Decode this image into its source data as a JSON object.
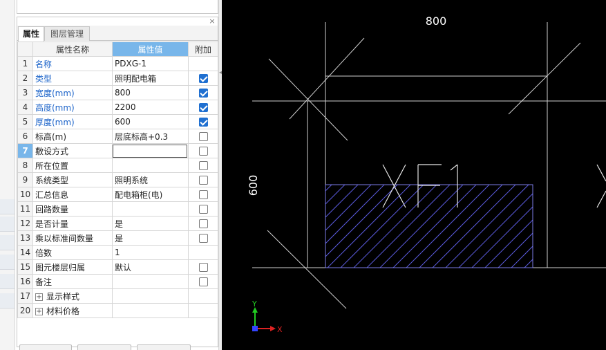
{
  "panel": {
    "close_glyph": "×",
    "tabs": {
      "properties": "属性",
      "layers": "图层管理"
    },
    "columns": {
      "name": "属性名称",
      "value": "属性值",
      "extra": "附加"
    },
    "rows": [
      {
        "num": "1",
        "name": "名称",
        "value": "PDXG-1",
        "blue": true,
        "check": null
      },
      {
        "num": "2",
        "name": "类型",
        "value": "照明配电箱",
        "blue": true,
        "check": true
      },
      {
        "num": "3",
        "name": "宽度(mm)",
        "value": "800",
        "blue": true,
        "check": true
      },
      {
        "num": "4",
        "name": "高度(mm)",
        "value": "2200",
        "blue": true,
        "check": true
      },
      {
        "num": "5",
        "name": "厚度(mm)",
        "value": "600",
        "blue": true,
        "check": true
      },
      {
        "num": "6",
        "name": "标高(m)",
        "value": "层底标高+0.3",
        "blue": false,
        "check": false
      },
      {
        "num": "7",
        "name": "敷设方式",
        "value": "",
        "blue": false,
        "check": false,
        "selected": true,
        "editing": true
      },
      {
        "num": "8",
        "name": "所在位置",
        "value": "",
        "blue": false,
        "check": false
      },
      {
        "num": "9",
        "name": "系统类型",
        "value": "照明系统",
        "blue": false,
        "check": false
      },
      {
        "num": "10",
        "name": "汇总信息",
        "value": "配电箱柜(电)",
        "blue": false,
        "check": false
      },
      {
        "num": "11",
        "name": "回路数量",
        "value": "",
        "blue": false,
        "check": false
      },
      {
        "num": "12",
        "name": "是否计量",
        "value": "是",
        "blue": false,
        "check": false
      },
      {
        "num": "13",
        "name": "乘以标准间数量",
        "value": "是",
        "blue": false,
        "check": false
      },
      {
        "num": "14",
        "name": "倍数",
        "value": "1",
        "blue": false,
        "check": null
      },
      {
        "num": "15",
        "name": "图元楼层归属",
        "value": "默认",
        "blue": false,
        "check": false
      },
      {
        "num": "16",
        "name": "备注",
        "value": "",
        "blue": false,
        "check": false
      },
      {
        "num": "17",
        "name": "显示样式",
        "value": "",
        "blue": false,
        "check": null,
        "group": true
      },
      {
        "num": "20",
        "name": "材料价格",
        "value": "",
        "blue": false,
        "check": null,
        "group": true
      }
    ],
    "expander_glyph": "+"
  },
  "canvas": {
    "dimension_top": "800",
    "dimension_left": "600",
    "label": "XF1",
    "axis_y": "Y",
    "axis_x": "X",
    "colors": {
      "background": "#000000",
      "lines": "#cfcfcf",
      "hatch": "#5a5adc",
      "axis_y": "#22cc22",
      "axis_x": "#dd2222",
      "origin": "#3344ff"
    }
  }
}
